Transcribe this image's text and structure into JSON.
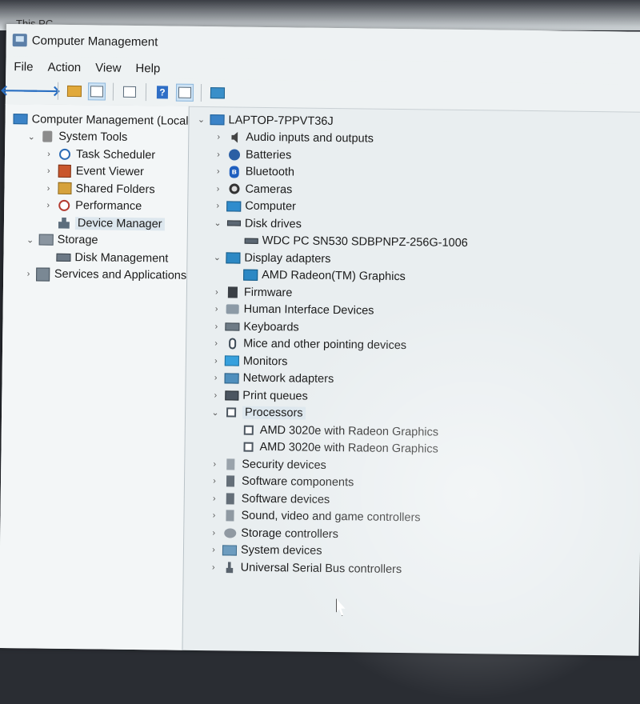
{
  "parent_window": {
    "title": "This PC"
  },
  "window": {
    "title": "Computer Management"
  },
  "menu": [
    "File",
    "Action",
    "View",
    "Help"
  ],
  "toolbar": {
    "buttons": [
      {
        "name": "back-arrow-icon",
        "glyph": "🡐"
      },
      {
        "name": "forward-arrow-icon",
        "glyph": "🡒"
      },
      {
        "name": "up-folder-icon",
        "glyph": ""
      },
      {
        "name": "show-hide-console-tree-icon",
        "glyph": ""
      },
      {
        "name": "properties-icon",
        "glyph": ""
      },
      {
        "name": "help-icon",
        "glyph": "?"
      },
      {
        "name": "show-hide-action-pane-icon",
        "glyph": ""
      },
      {
        "name": "scan-hardware-icon",
        "glyph": ""
      }
    ]
  },
  "left_tree": [
    {
      "label": "Computer Management (Local",
      "level": 0,
      "chevron": "",
      "icon": "i-pc"
    },
    {
      "label": "System Tools",
      "level": 1,
      "chevron": "⌄",
      "icon": "i-tools"
    },
    {
      "label": "Task Scheduler",
      "level": 2,
      "chevron": "›",
      "icon": "i-clock"
    },
    {
      "label": "Event Viewer",
      "level": 2,
      "chevron": "›",
      "icon": "i-viewer"
    },
    {
      "label": "Shared Folders",
      "level": 2,
      "chevron": "›",
      "icon": "i-share"
    },
    {
      "label": "Performance",
      "level": 2,
      "chevron": "›",
      "icon": "i-perf"
    },
    {
      "label": "Device Manager",
      "level": 2,
      "chevron": "",
      "icon": "i-dev",
      "selected": true
    },
    {
      "label": "Storage",
      "level": 1,
      "chevron": "⌄",
      "icon": "i-storage"
    },
    {
      "label": "Disk Management",
      "level": 2,
      "chevron": "",
      "icon": "i-disk"
    },
    {
      "label": "Services and Applications",
      "level": 1,
      "chevron": "›",
      "icon": "i-svc"
    }
  ],
  "device_tree": [
    {
      "label": "LAPTOP-7PPVT36J",
      "level": 0,
      "chevron": "⌄",
      "icon": "i-pc"
    },
    {
      "label": "Audio inputs and outputs",
      "level": 1,
      "chevron": "›",
      "icon": "i-audio"
    },
    {
      "label": "Batteries",
      "level": 1,
      "chevron": "›",
      "icon": "i-battery"
    },
    {
      "label": "Bluetooth",
      "level": 1,
      "chevron": "›",
      "icon": "i-bt"
    },
    {
      "label": "Cameras",
      "level": 1,
      "chevron": "›",
      "icon": "i-cam"
    },
    {
      "label": "Computer",
      "level": 1,
      "chevron": "›",
      "icon": "i-comp"
    },
    {
      "label": "Disk drives",
      "level": 1,
      "chevron": "⌄",
      "icon": "i-drive"
    },
    {
      "label": "WDC PC SN530 SDBPNPZ-256G-1006",
      "level": 2,
      "chevron": "",
      "icon": "i-drive"
    },
    {
      "label": "Display adapters",
      "level": 1,
      "chevron": "⌄",
      "icon": "i-display"
    },
    {
      "label": "AMD Radeon(TM) Graphics",
      "level": 2,
      "chevron": "",
      "icon": "i-display"
    },
    {
      "label": "Firmware",
      "level": 1,
      "chevron": "›",
      "icon": "i-chip"
    },
    {
      "label": "Human Interface Devices",
      "level": 1,
      "chevron": "›",
      "icon": "i-hid"
    },
    {
      "label": "Keyboards",
      "level": 1,
      "chevron": "›",
      "icon": "i-kbd"
    },
    {
      "label": "Mice and other pointing devices",
      "level": 1,
      "chevron": "›",
      "icon": "i-mouse"
    },
    {
      "label": "Monitors",
      "level": 1,
      "chevron": "›",
      "icon": "i-mon"
    },
    {
      "label": "Network adapters",
      "level": 1,
      "chevron": "›",
      "icon": "i-net"
    },
    {
      "label": "Print queues",
      "level": 1,
      "chevron": "›",
      "icon": "i-print"
    },
    {
      "label": "Processors",
      "level": 1,
      "chevron": "⌄",
      "icon": "i-proc",
      "selected": true
    },
    {
      "label": "AMD 3020e with Radeon Graphics",
      "level": 2,
      "chevron": "",
      "icon": "i-proc"
    },
    {
      "label": "AMD 3020e with Radeon Graphics",
      "level": 2,
      "chevron": "",
      "icon": "i-proc"
    },
    {
      "label": "Security devices",
      "level": 1,
      "chevron": "›",
      "icon": "i-sec"
    },
    {
      "label": "Software components",
      "level": 1,
      "chevron": "›",
      "icon": "i-swc"
    },
    {
      "label": "Software devices",
      "level": 1,
      "chevron": "›",
      "icon": "i-swc"
    },
    {
      "label": "Sound, video and game controllers",
      "level": 1,
      "chevron": "›",
      "icon": "i-sound"
    },
    {
      "label": "Storage controllers",
      "level": 1,
      "chevron": "›",
      "icon": "i-stor"
    },
    {
      "label": "System devices",
      "level": 1,
      "chevron": "›",
      "icon": "i-sys"
    },
    {
      "label": "Universal Serial Bus controllers",
      "level": 1,
      "chevron": "›",
      "icon": "i-usb"
    }
  ]
}
